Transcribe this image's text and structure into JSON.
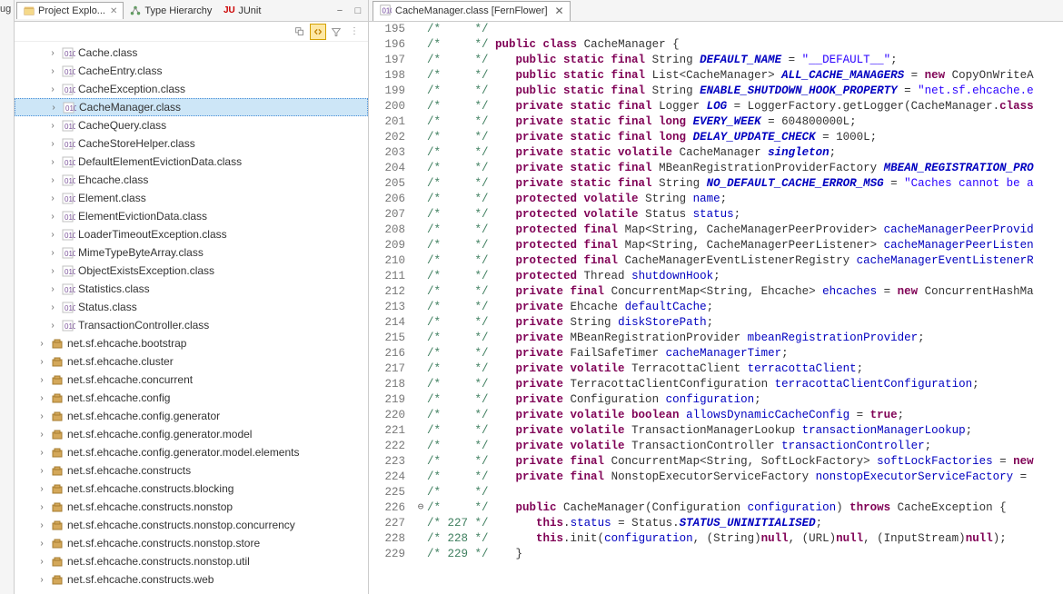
{
  "leftStrip": "ug",
  "viewTabs": {
    "projectExplorer": {
      "label": "Project Explo...",
      "close": "✕"
    },
    "typeHierarchy": {
      "label": "Type Hierarchy"
    },
    "junit": {
      "label": "JUnit"
    }
  },
  "minMax": {
    "min": "▭",
    "max": "▢"
  },
  "tree": {
    "classes": [
      "Cache.class",
      "CacheEntry.class",
      "CacheException.class",
      "CacheManager.class",
      "CacheQuery.class",
      "CacheStoreHelper.class",
      "DefaultElementEvictionData.class",
      "Ehcache.class",
      "Element.class",
      "ElementEvictionData.class",
      "LoaderTimeoutException.class",
      "MimeTypeByteArray.class",
      "ObjectExistsException.class",
      "Statistics.class",
      "Status.class",
      "TransactionController.class"
    ],
    "selected": "CacheManager.class",
    "packages": [
      "net.sf.ehcache.bootstrap",
      "net.sf.ehcache.cluster",
      "net.sf.ehcache.concurrent",
      "net.sf.ehcache.config",
      "net.sf.ehcache.config.generator",
      "net.sf.ehcache.config.generator.model",
      "net.sf.ehcache.config.generator.model.elements",
      "net.sf.ehcache.constructs",
      "net.sf.ehcache.constructs.blocking",
      "net.sf.ehcache.constructs.nonstop",
      "net.sf.ehcache.constructs.nonstop.concurrency",
      "net.sf.ehcache.constructs.nonstop.store",
      "net.sf.ehcache.constructs.nonstop.util",
      "net.sf.ehcache.constructs.web"
    ]
  },
  "editor": {
    "tabTitle": "CacheManager.class [FernFlower]",
    "close": "✕",
    "startLine": 195,
    "foldLine": 226,
    "lines": [
      {
        "n": 195,
        "c": "     */"
      },
      {
        "n": 196,
        "c": "     */",
        "code": [
          [
            "kw",
            "public"
          ],
          [
            "",
            ""
          ],
          [
            "kw",
            " class"
          ],
          [
            "",
            " CacheManager {"
          ]
        ]
      },
      {
        "n": 197,
        "c": "     */",
        "code": [
          [
            "",
            "   "
          ],
          [
            "kw",
            "public static final"
          ],
          [
            "",
            " String "
          ],
          [
            "static-var",
            "DEFAULT_NAME"
          ],
          [
            "",
            " = "
          ],
          [
            "str",
            "\"__DEFAULT__\""
          ],
          [
            "",
            ";"
          ]
        ]
      },
      {
        "n": 198,
        "c": "     */",
        "code": [
          [
            "",
            "   "
          ],
          [
            "kw",
            "public static final"
          ],
          [
            "",
            " List<CacheManager> "
          ],
          [
            "static-var",
            "ALL_CACHE_MANAGERS"
          ],
          [
            "",
            " = "
          ],
          [
            "kw",
            "new"
          ],
          [
            "",
            " CopyOnWriteA"
          ]
        ]
      },
      {
        "n": 199,
        "c": "     */",
        "code": [
          [
            "",
            "   "
          ],
          [
            "kw",
            "public static final"
          ],
          [
            "",
            " String "
          ],
          [
            "static-var",
            "ENABLE_SHUTDOWN_HOOK_PROPERTY"
          ],
          [
            "",
            " = "
          ],
          [
            "str",
            "\"net.sf.ehcache.e"
          ]
        ]
      },
      {
        "n": 200,
        "c": "     */",
        "code": [
          [
            "",
            "   "
          ],
          [
            "kw",
            "private static final"
          ],
          [
            "",
            " Logger "
          ],
          [
            "static-var",
            "LOG"
          ],
          [
            "",
            " = LoggerFactory."
          ],
          [
            "",
            "getLogger"
          ],
          [
            "",
            "(CacheManager."
          ],
          [
            "kw",
            "class"
          ]
        ]
      },
      {
        "n": 201,
        "c": "     */",
        "code": [
          [
            "",
            "   "
          ],
          [
            "kw",
            "private static final long"
          ],
          [
            "",
            " "
          ],
          [
            "static-var",
            "EVERY_WEEK"
          ],
          [
            "",
            " = 604800000L;"
          ]
        ]
      },
      {
        "n": 202,
        "c": "     */",
        "code": [
          [
            "",
            "   "
          ],
          [
            "kw",
            "private static final long"
          ],
          [
            "",
            " "
          ],
          [
            "static-var",
            "DELAY_UPDATE_CHECK"
          ],
          [
            "",
            " = 1000L;"
          ]
        ]
      },
      {
        "n": 203,
        "c": "     */",
        "code": [
          [
            "",
            "   "
          ],
          [
            "kw",
            "private static volatile"
          ],
          [
            "",
            " CacheManager "
          ],
          [
            "static-var",
            "singleton"
          ],
          [
            "",
            ";"
          ]
        ]
      },
      {
        "n": 204,
        "c": "     */",
        "code": [
          [
            "",
            "   "
          ],
          [
            "kw",
            "private static final"
          ],
          [
            "",
            " MBeanRegistrationProviderFactory "
          ],
          [
            "static-var",
            "MBEAN_REGISTRATION_PRO"
          ]
        ]
      },
      {
        "n": 205,
        "c": "     */",
        "code": [
          [
            "",
            "   "
          ],
          [
            "kw",
            "private static final"
          ],
          [
            "",
            " String "
          ],
          [
            "static-var",
            "NO_DEFAULT_CACHE_ERROR_MSG"
          ],
          [
            "",
            " = "
          ],
          [
            "str",
            "\"Caches cannot be a"
          ]
        ]
      },
      {
        "n": 206,
        "c": "     */",
        "code": [
          [
            "",
            "   "
          ],
          [
            "kw",
            "protected volatile"
          ],
          [
            "",
            " String "
          ],
          [
            "field",
            "name"
          ],
          [
            "",
            ";"
          ]
        ]
      },
      {
        "n": 207,
        "c": "     */",
        "code": [
          [
            "",
            "   "
          ],
          [
            "kw",
            "protected volatile"
          ],
          [
            "",
            " Status "
          ],
          [
            "field",
            "status"
          ],
          [
            "",
            ";"
          ]
        ]
      },
      {
        "n": 208,
        "c": "     */",
        "code": [
          [
            "",
            "   "
          ],
          [
            "kw",
            "protected final"
          ],
          [
            "",
            " Map<String, CacheManagerPeerProvider> "
          ],
          [
            "field",
            "cacheManagerPeerProvid"
          ]
        ]
      },
      {
        "n": 209,
        "c": "     */",
        "code": [
          [
            "",
            "   "
          ],
          [
            "kw",
            "protected final"
          ],
          [
            "",
            " Map<String, CacheManagerPeerListener> "
          ],
          [
            "field",
            "cacheManagerPeerListen"
          ]
        ]
      },
      {
        "n": 210,
        "c": "     */",
        "code": [
          [
            "",
            "   "
          ],
          [
            "kw",
            "protected final"
          ],
          [
            "",
            " CacheManagerEventListenerRegistry "
          ],
          [
            "field",
            "cacheManagerEventListenerR"
          ]
        ]
      },
      {
        "n": 211,
        "c": "     */",
        "code": [
          [
            "",
            "   "
          ],
          [
            "kw",
            "protected"
          ],
          [
            "",
            " Thread "
          ],
          [
            "field",
            "shutdownHook"
          ],
          [
            "",
            ";"
          ]
        ]
      },
      {
        "n": 212,
        "c": "     */",
        "code": [
          [
            "",
            "   "
          ],
          [
            "kw",
            "private final"
          ],
          [
            "",
            " ConcurrentMap<String, Ehcache> "
          ],
          [
            "field",
            "ehcaches"
          ],
          [
            "",
            " = "
          ],
          [
            "kw",
            "new"
          ],
          [
            "",
            " ConcurrentHashMa"
          ]
        ]
      },
      {
        "n": 213,
        "c": "     */",
        "code": [
          [
            "",
            "   "
          ],
          [
            "kw",
            "private"
          ],
          [
            "",
            " Ehcache "
          ],
          [
            "field",
            "defaultCache"
          ],
          [
            "",
            ";"
          ]
        ]
      },
      {
        "n": 214,
        "c": "     */",
        "code": [
          [
            "",
            "   "
          ],
          [
            "kw",
            "private"
          ],
          [
            "",
            " String "
          ],
          [
            "field",
            "diskStorePath"
          ],
          [
            "",
            ";"
          ]
        ]
      },
      {
        "n": 215,
        "c": "     */",
        "code": [
          [
            "",
            "   "
          ],
          [
            "kw",
            "private"
          ],
          [
            "",
            " MBeanRegistrationProvider "
          ],
          [
            "field",
            "mbeanRegistrationProvider"
          ],
          [
            "",
            ";"
          ]
        ]
      },
      {
        "n": 216,
        "c": "     */",
        "code": [
          [
            "",
            "   "
          ],
          [
            "kw",
            "private"
          ],
          [
            "",
            " FailSafeTimer "
          ],
          [
            "field",
            "cacheManagerTimer"
          ],
          [
            "",
            ";"
          ]
        ]
      },
      {
        "n": 217,
        "c": "     */",
        "code": [
          [
            "",
            "   "
          ],
          [
            "kw",
            "private volatile"
          ],
          [
            "",
            " TerracottaClient "
          ],
          [
            "field",
            "terracottaClient"
          ],
          [
            "",
            ";"
          ]
        ]
      },
      {
        "n": 218,
        "c": "     */",
        "code": [
          [
            "",
            "   "
          ],
          [
            "kw",
            "private"
          ],
          [
            "",
            " TerracottaClientConfiguration "
          ],
          [
            "field",
            "terracottaClientConfiguration"
          ],
          [
            "",
            ";"
          ]
        ]
      },
      {
        "n": 219,
        "c": "     */",
        "code": [
          [
            "",
            "   "
          ],
          [
            "kw",
            "private"
          ],
          [
            "",
            " Configuration "
          ],
          [
            "field",
            "configuration"
          ],
          [
            "",
            ";"
          ]
        ]
      },
      {
        "n": 220,
        "c": "     */",
        "code": [
          [
            "",
            "   "
          ],
          [
            "kw",
            "private volatile boolean"
          ],
          [
            "",
            " "
          ],
          [
            "field",
            "allowsDynamicCacheConfig"
          ],
          [
            "",
            " = "
          ],
          [
            "kw",
            "true"
          ],
          [
            "",
            ";"
          ]
        ]
      },
      {
        "n": 221,
        "c": "     */",
        "code": [
          [
            "",
            "   "
          ],
          [
            "kw",
            "private volatile"
          ],
          [
            "",
            " TransactionManagerLookup "
          ],
          [
            "field",
            "transactionManagerLookup"
          ],
          [
            "",
            ";"
          ]
        ]
      },
      {
        "n": 222,
        "c": "     */",
        "code": [
          [
            "",
            "   "
          ],
          [
            "kw",
            "private volatile"
          ],
          [
            "",
            " TransactionController "
          ],
          [
            "field",
            "transactionController"
          ],
          [
            "",
            ";"
          ]
        ]
      },
      {
        "n": 223,
        "c": "     */",
        "code": [
          [
            "",
            "   "
          ],
          [
            "kw",
            "private final"
          ],
          [
            "",
            " ConcurrentMap<String, SoftLockFactory> "
          ],
          [
            "field",
            "softLockFactories"
          ],
          [
            "",
            " = "
          ],
          [
            "kw",
            "new"
          ]
        ]
      },
      {
        "n": 224,
        "c": "     */",
        "code": [
          [
            "",
            "   "
          ],
          [
            "kw",
            "private final"
          ],
          [
            "",
            " NonstopExecutorServiceFactory "
          ],
          [
            "field",
            "nonstopExecutorServiceFactory"
          ],
          [
            "",
            " = "
          ]
        ]
      },
      {
        "n": 225,
        "c": "     */"
      },
      {
        "n": 226,
        "c": "     */",
        "code": [
          [
            "",
            "   "
          ],
          [
            "kw",
            "public"
          ],
          [
            "",
            " CacheManager(Configuration "
          ],
          [
            "field",
            "configuration"
          ],
          [
            "",
            ") "
          ],
          [
            "kw",
            "throws"
          ],
          [
            "",
            " CacheException {"
          ]
        ]
      },
      {
        "n": 227,
        "c": " 227 */",
        "code": [
          [
            "",
            "      "
          ],
          [
            "kw",
            "this"
          ],
          [
            "",
            "."
          ],
          [
            "field",
            "status"
          ],
          [
            "",
            " = Status."
          ],
          [
            "static-var",
            "STATUS_UNINITIALISED"
          ],
          [
            "",
            ";"
          ]
        ]
      },
      {
        "n": 228,
        "c": " 228 */",
        "code": [
          [
            "",
            "      "
          ],
          [
            "kw",
            "this"
          ],
          [
            "",
            ".init("
          ],
          [
            "field",
            "configuration"
          ],
          [
            "",
            ", (String)"
          ],
          [
            "kw",
            "null"
          ],
          [
            "",
            ", (URL)"
          ],
          [
            "kw",
            "null"
          ],
          [
            "",
            ", (InputStream)"
          ],
          [
            "kw",
            "null"
          ],
          [
            "",
            ");"
          ]
        ]
      },
      {
        "n": 229,
        "c": " 229 */",
        "code": [
          [
            "",
            "   }"
          ]
        ]
      }
    ]
  }
}
